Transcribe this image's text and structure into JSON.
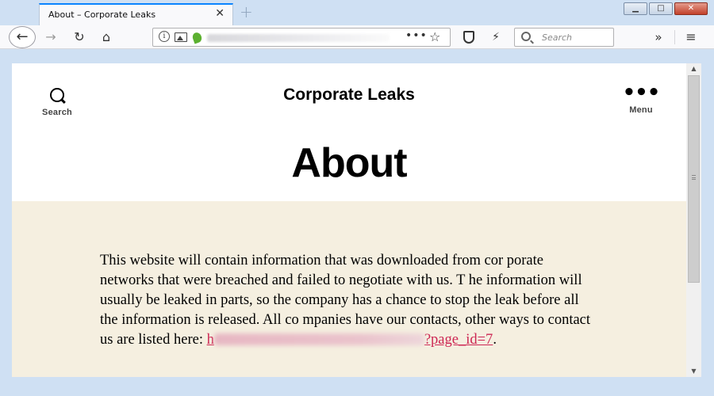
{
  "browser": {
    "tab": {
      "title": "About – Corporate Leaks",
      "close_glyph": "✕"
    },
    "new_tab_glyph": "+",
    "window_controls": {
      "minimize": "▁",
      "maximize": "□",
      "close": "✕"
    },
    "toolbar": {
      "back_icon": "←",
      "forward_icon": "→",
      "reload_icon": "↻",
      "home_icon": "⌂",
      "page_actions_icon": "•••",
      "bookmark_icon": "☆",
      "tracking_icon": "⚡",
      "overflow_icon": "»",
      "menu_icon": "≡"
    },
    "address_bar": {
      "info_glyph": "i"
    },
    "search_box": {
      "placeholder": "Search"
    }
  },
  "site": {
    "title": "Corporate Leaks",
    "header_search_label": "Search",
    "header_menu_label": "Menu",
    "menu_dots": "•••",
    "page_title": "About",
    "body_text": "This website will contain information that was downloaded from cor porate networks that were breached and failed to negotiate with us. T he information will usually be leaked in parts, so the company has a chance to stop the leak before all the information is released. All co mpanies have our contacts, other ways to contact us are listed here: ",
    "link_start": "h",
    "link_end": "?page_id=7",
    "body_tail": ".",
    "colors": {
      "content_bg": "#f5efe0",
      "link": "#cd2653",
      "accent_tab": "#0a84ff"
    }
  },
  "scrollbar": {
    "up_glyph": "▲",
    "down_glyph": "▼"
  }
}
